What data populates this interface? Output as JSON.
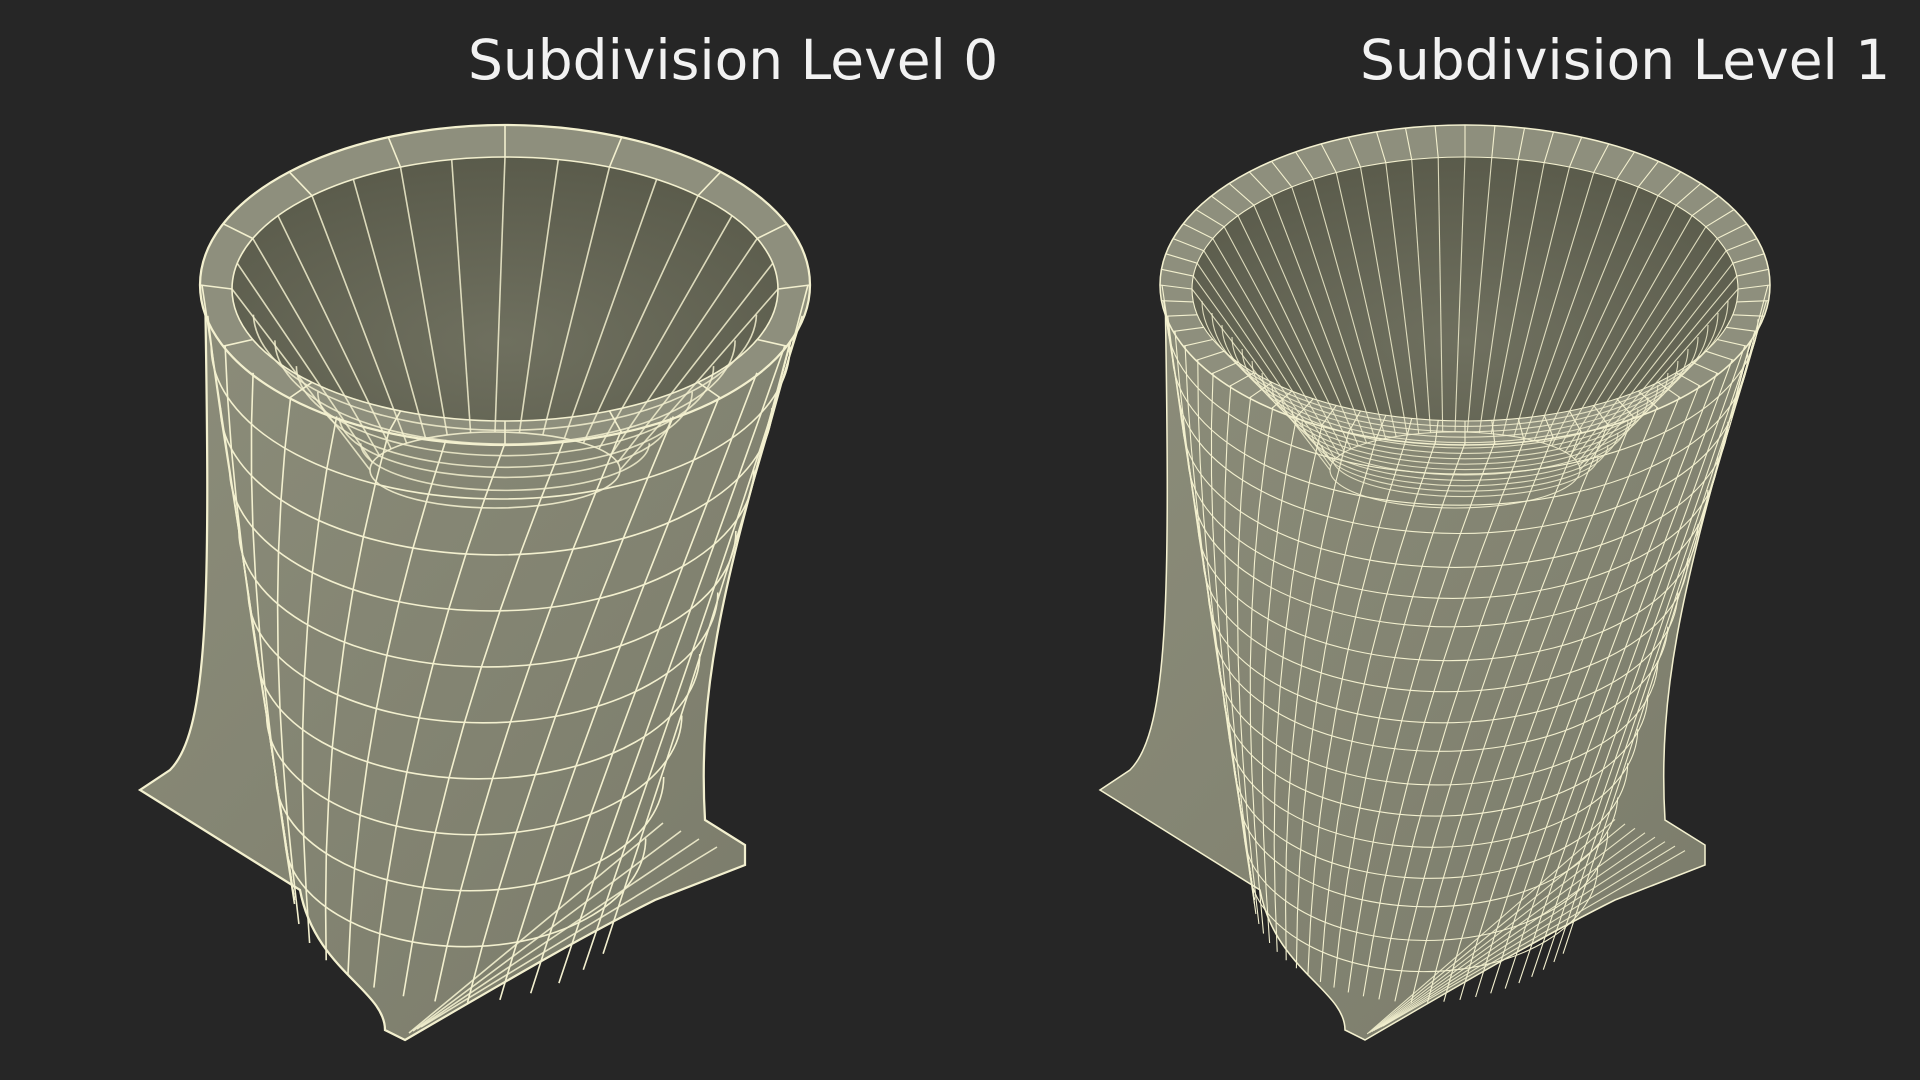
{
  "labels": {
    "left": "Subdivision Level 0",
    "right": "Subdivision Level 1"
  },
  "colors": {
    "background": "#262626",
    "mesh_fill_outer": "#7a7b6a",
    "mesh_fill_inner": "#5a5b4b",
    "wire": "#f3f0cf",
    "text": "#f2f2f2"
  }
}
